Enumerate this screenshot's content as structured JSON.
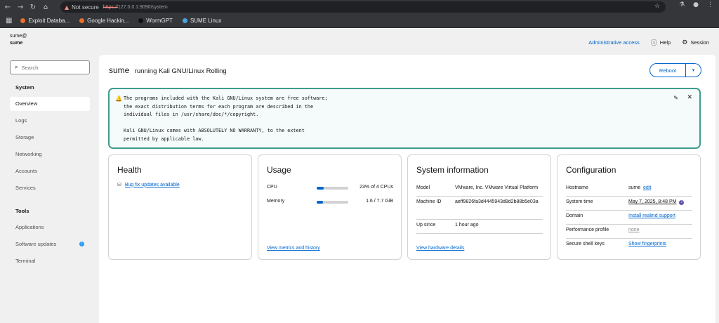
{
  "browser": {
    "not_secure": "Not secure",
    "url_scheme": "https://",
    "url_rest": "127.0.0.1:9090/system",
    "bookmarks": [
      {
        "label": "Exploit Databa...",
        "color": "#e8702a"
      },
      {
        "label": "Google Hackin...",
        "color": "#e8702a"
      },
      {
        "label": "WormGPT",
        "color": "#1a1a1a"
      },
      {
        "label": "SUME Linux",
        "color": "#4aa3df"
      }
    ]
  },
  "header": {
    "user_line": "sume@",
    "host_line": "sume",
    "admin_access": "Administrative access",
    "help": "Help",
    "session": "Session"
  },
  "sidebar": {
    "search_placeholder": "Search",
    "system_heading": "System",
    "system_items": [
      "Overview",
      "Logs",
      "Storage",
      "Networking",
      "Accounts",
      "Services"
    ],
    "tools_heading": "Tools",
    "tools_items": [
      "Applications",
      "Software updates",
      "Terminal"
    ]
  },
  "page": {
    "hostname": "sume",
    "os_text": "running Kali GNU/Linux Rolling",
    "reboot_label": "Reboot",
    "motd": "The programs included with the Kali GNU/Linux system are free software;\nthe exact distribution terms for each program are described in the\nindividual files in /usr/share/doc/*/copyright.\n\nKali GNU/Linux comes with ABSOLUTELY NO WARRANTY, to the extent\npermitted by applicable law."
  },
  "health": {
    "title": "Health",
    "updates_link": "Bug fix updates available"
  },
  "usage": {
    "title": "Usage",
    "cpu_label": "CPU",
    "cpu_value": "23% of 4 CPUs",
    "cpu_fraction": 0.23,
    "memory_label": "Memory",
    "memory_value": "1.6 / 7.7 GiB",
    "memory_fraction": 0.21,
    "metrics_link": "View metrics and history"
  },
  "sysinfo": {
    "title": "System information",
    "model_label": "Model",
    "model_value": "VMware, Inc. VMware Virtual Platform",
    "machine_id_label": "Machine ID",
    "machine_id_value": "aeff9826fa3d4445943d8d2b88b5e03a",
    "up_since_label": "Up since",
    "up_since_value": "1 hour ago",
    "hardware_link": "View hardware details"
  },
  "config": {
    "title": "Configuration",
    "hostname_label": "Hostname",
    "hostname_value": "sume",
    "hostname_edit": "edit",
    "time_label": "System time",
    "time_value": "May 7, 2025, 8:48 PM",
    "domain_label": "Domain",
    "domain_value": "Install realmd support",
    "perf_label": "Performance profile",
    "perf_value": "none",
    "ssh_label": "Secure shell keys",
    "ssh_value": "Show fingerprints"
  }
}
